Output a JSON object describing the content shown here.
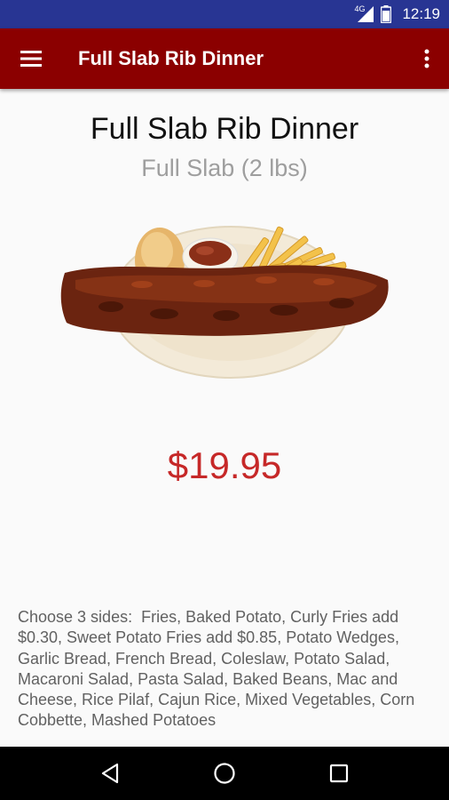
{
  "status_bar": {
    "network": "4G",
    "time": "12:19",
    "icons": [
      "signal-icon",
      "battery-icon"
    ]
  },
  "app_bar": {
    "title": "Full Slab Rib Dinner",
    "icons": [
      "menu-icon",
      "overflow-menu-icon"
    ],
    "color": "#8b0000"
  },
  "item": {
    "name": "Full Slab Rib Dinner",
    "portion": "Full Slab (2 lbs)",
    "image": "rib-dinner-photo",
    "price": "$19.95",
    "price_color": "#c62828",
    "description": "Choose 3 sides:  Fries, Baked Potato, Curly Fries add $0.30, Sweet Potato Fries add $0.85, Potato Wedges, Garlic Bread, French Bread, Coleslaw, Potato Salad, Macaroni Salad, Pasta Salad, Baked Beans, Mac and Cheese, Rice Pilaf, Cajun Rice, Mixed Vegetables, Corn Cobbette, Mashed Potatoes"
  },
  "nav_bar": {
    "icons": [
      "back-icon",
      "home-icon",
      "recents-icon"
    ]
  }
}
